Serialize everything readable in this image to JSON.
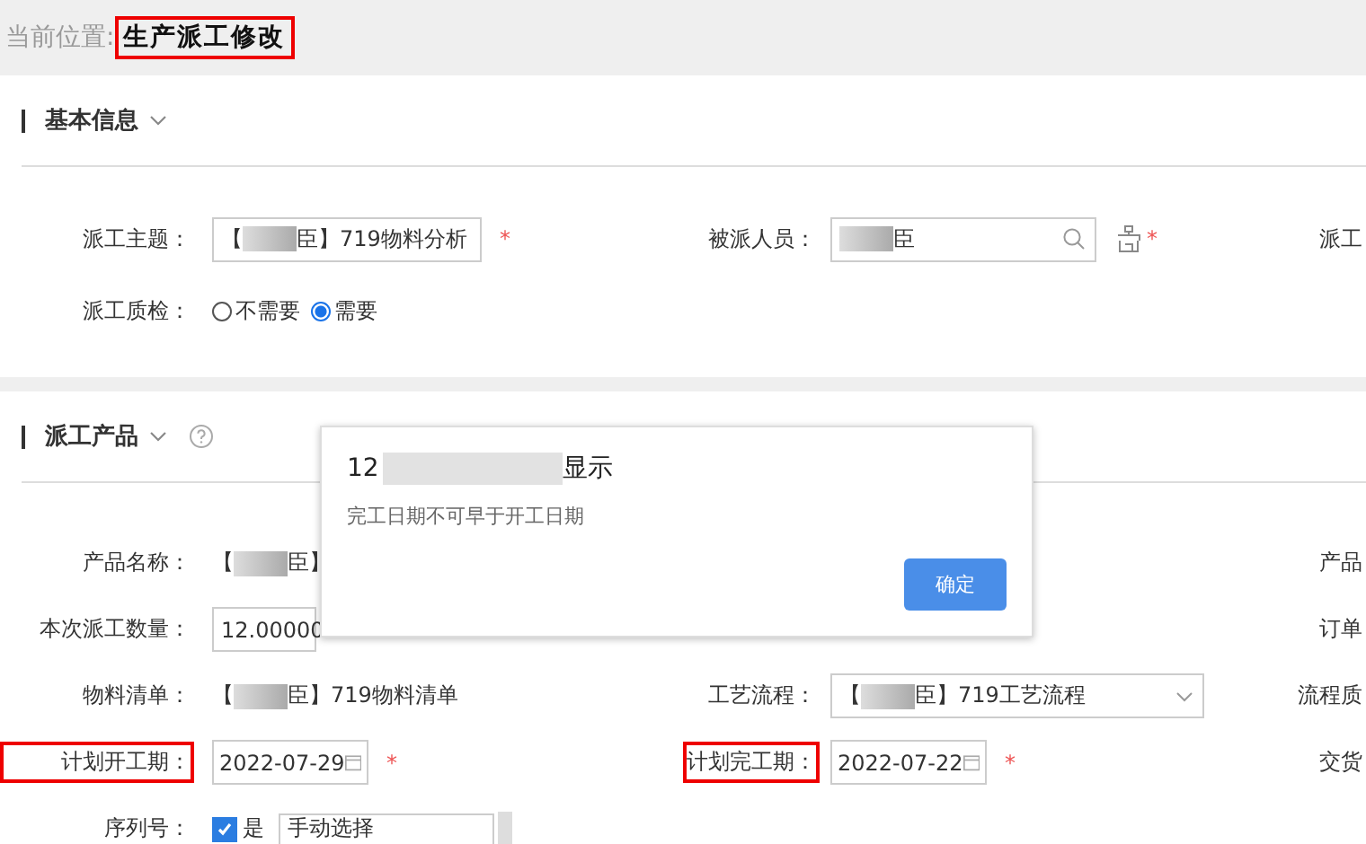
{
  "breadcrumb": {
    "label": "当前位置:",
    "current": "生产派工修改",
    "highlighted": true
  },
  "sections": [
    {
      "title": "基本信息",
      "rows": [
        [
          {
            "label": "派工主题：",
            "kind": "input",
            "parts": [
              "【",
              "臣】719物料分析"
            ],
            "required": "*"
          },
          {
            "label": "被派人员：",
            "kind": "lookup",
            "redacted_start": true,
            "parts": [
              "臣"
            ],
            "required": "*"
          },
          {
            "label": "派工",
            "kind": "cut"
          }
        ],
        [
          {
            "label": "派工质检：",
            "kind": "radio",
            "options": [
              {
                "label": "不需要",
                "selected": false
              },
              {
                "label": "需要",
                "selected": true
              }
            ]
          }
        ]
      ]
    },
    {
      "title": "派工产品",
      "help": true,
      "rows": [
        [
          {
            "label": "产品名称：",
            "kind": "text",
            "parts": [
              "【",
              "臣】"
            ]
          },
          {
            "kind": "empty"
          },
          {
            "label": "产品",
            "kind": "cut"
          }
        ],
        [
          {
            "label": "本次派工数量：",
            "kind": "input",
            "parts": [
              "12.00000"
            ],
            "narrow": true
          },
          {
            "kind": "empty"
          },
          {
            "label": "订单",
            "kind": "cut"
          }
        ],
        [
          {
            "label": "物料清单：",
            "kind": "text",
            "parts": [
              "【",
              "臣】719物料清单"
            ]
          },
          {
            "label": "工艺流程：",
            "kind": "select",
            "parts": [
              "【",
              "臣】719工艺流程"
            ]
          },
          {
            "label": "流程质",
            "kind": "cut"
          }
        ],
        [
          {
            "label": "计划开工期：",
            "kind": "date",
            "value": "2022-07-29",
            "required": "*",
            "highlighted": true
          },
          {
            "label": "计划完工期：",
            "kind": "date",
            "value": "2022-07-22",
            "required": "*",
            "highlighted": true
          },
          {
            "label": "交货",
            "kind": "cut"
          }
        ],
        [
          {
            "label": "序列号：",
            "kind": "check",
            "checked": true,
            "check_label": "是",
            "value": "手动选择"
          }
        ]
      ]
    }
  ],
  "dialog": {
    "title_parts": [
      "12",
      "显示"
    ],
    "message": "完工日期不可早于开工日期",
    "button": "确定"
  }
}
